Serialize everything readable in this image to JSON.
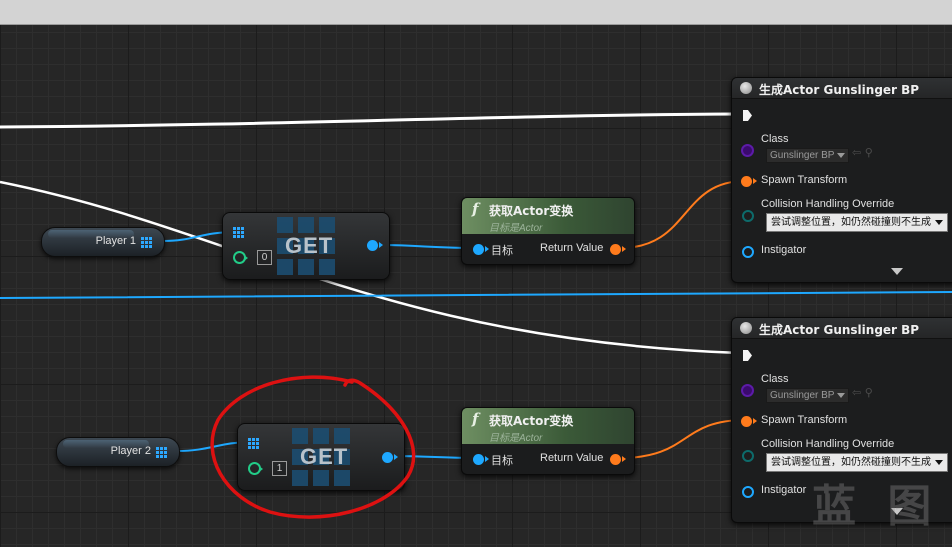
{
  "variables": [
    {
      "label": "Player 1"
    },
    {
      "label": "Player 2"
    }
  ],
  "get_nodes": [
    {
      "title": "GET",
      "index": "0"
    },
    {
      "title": "GET",
      "index": "1"
    }
  ],
  "transform_nodes": [
    {
      "title": "获取Actor变换",
      "subtitle": "目标是Actor",
      "target_label": "目标",
      "return_label": "Return Value"
    },
    {
      "title": "获取Actor变换",
      "subtitle": "目标是Actor",
      "target_label": "目标",
      "return_label": "Return Value"
    }
  ],
  "spawn_nodes": [
    {
      "title": "生成Actor Gunslinger BP",
      "class_label": "Class",
      "class_value": "Gunslinger BP",
      "spawn_transform_label": "Spawn Transform",
      "collision_label": "Collision Handling Override",
      "collision_value": "尝试调整位置，如仍然碰撞则不生成",
      "instigator_label": "Instigator"
    },
    {
      "title": "生成Actor Gunslinger BP",
      "class_label": "Class",
      "class_value": "Gunslinger BP",
      "spawn_transform_label": "Spawn Transform",
      "collision_label": "Collision Handling Override",
      "collision_value": "尝试调整位置，如仍然碰撞则不生成",
      "instigator_label": "Instigator"
    }
  ],
  "watermark": "蓝 图",
  "colors": {
    "exec_wire": "#ffffff",
    "object_wire": "#1ea8ff",
    "struct_wire": "#ff7b1c",
    "annotation": "#dd1111"
  }
}
